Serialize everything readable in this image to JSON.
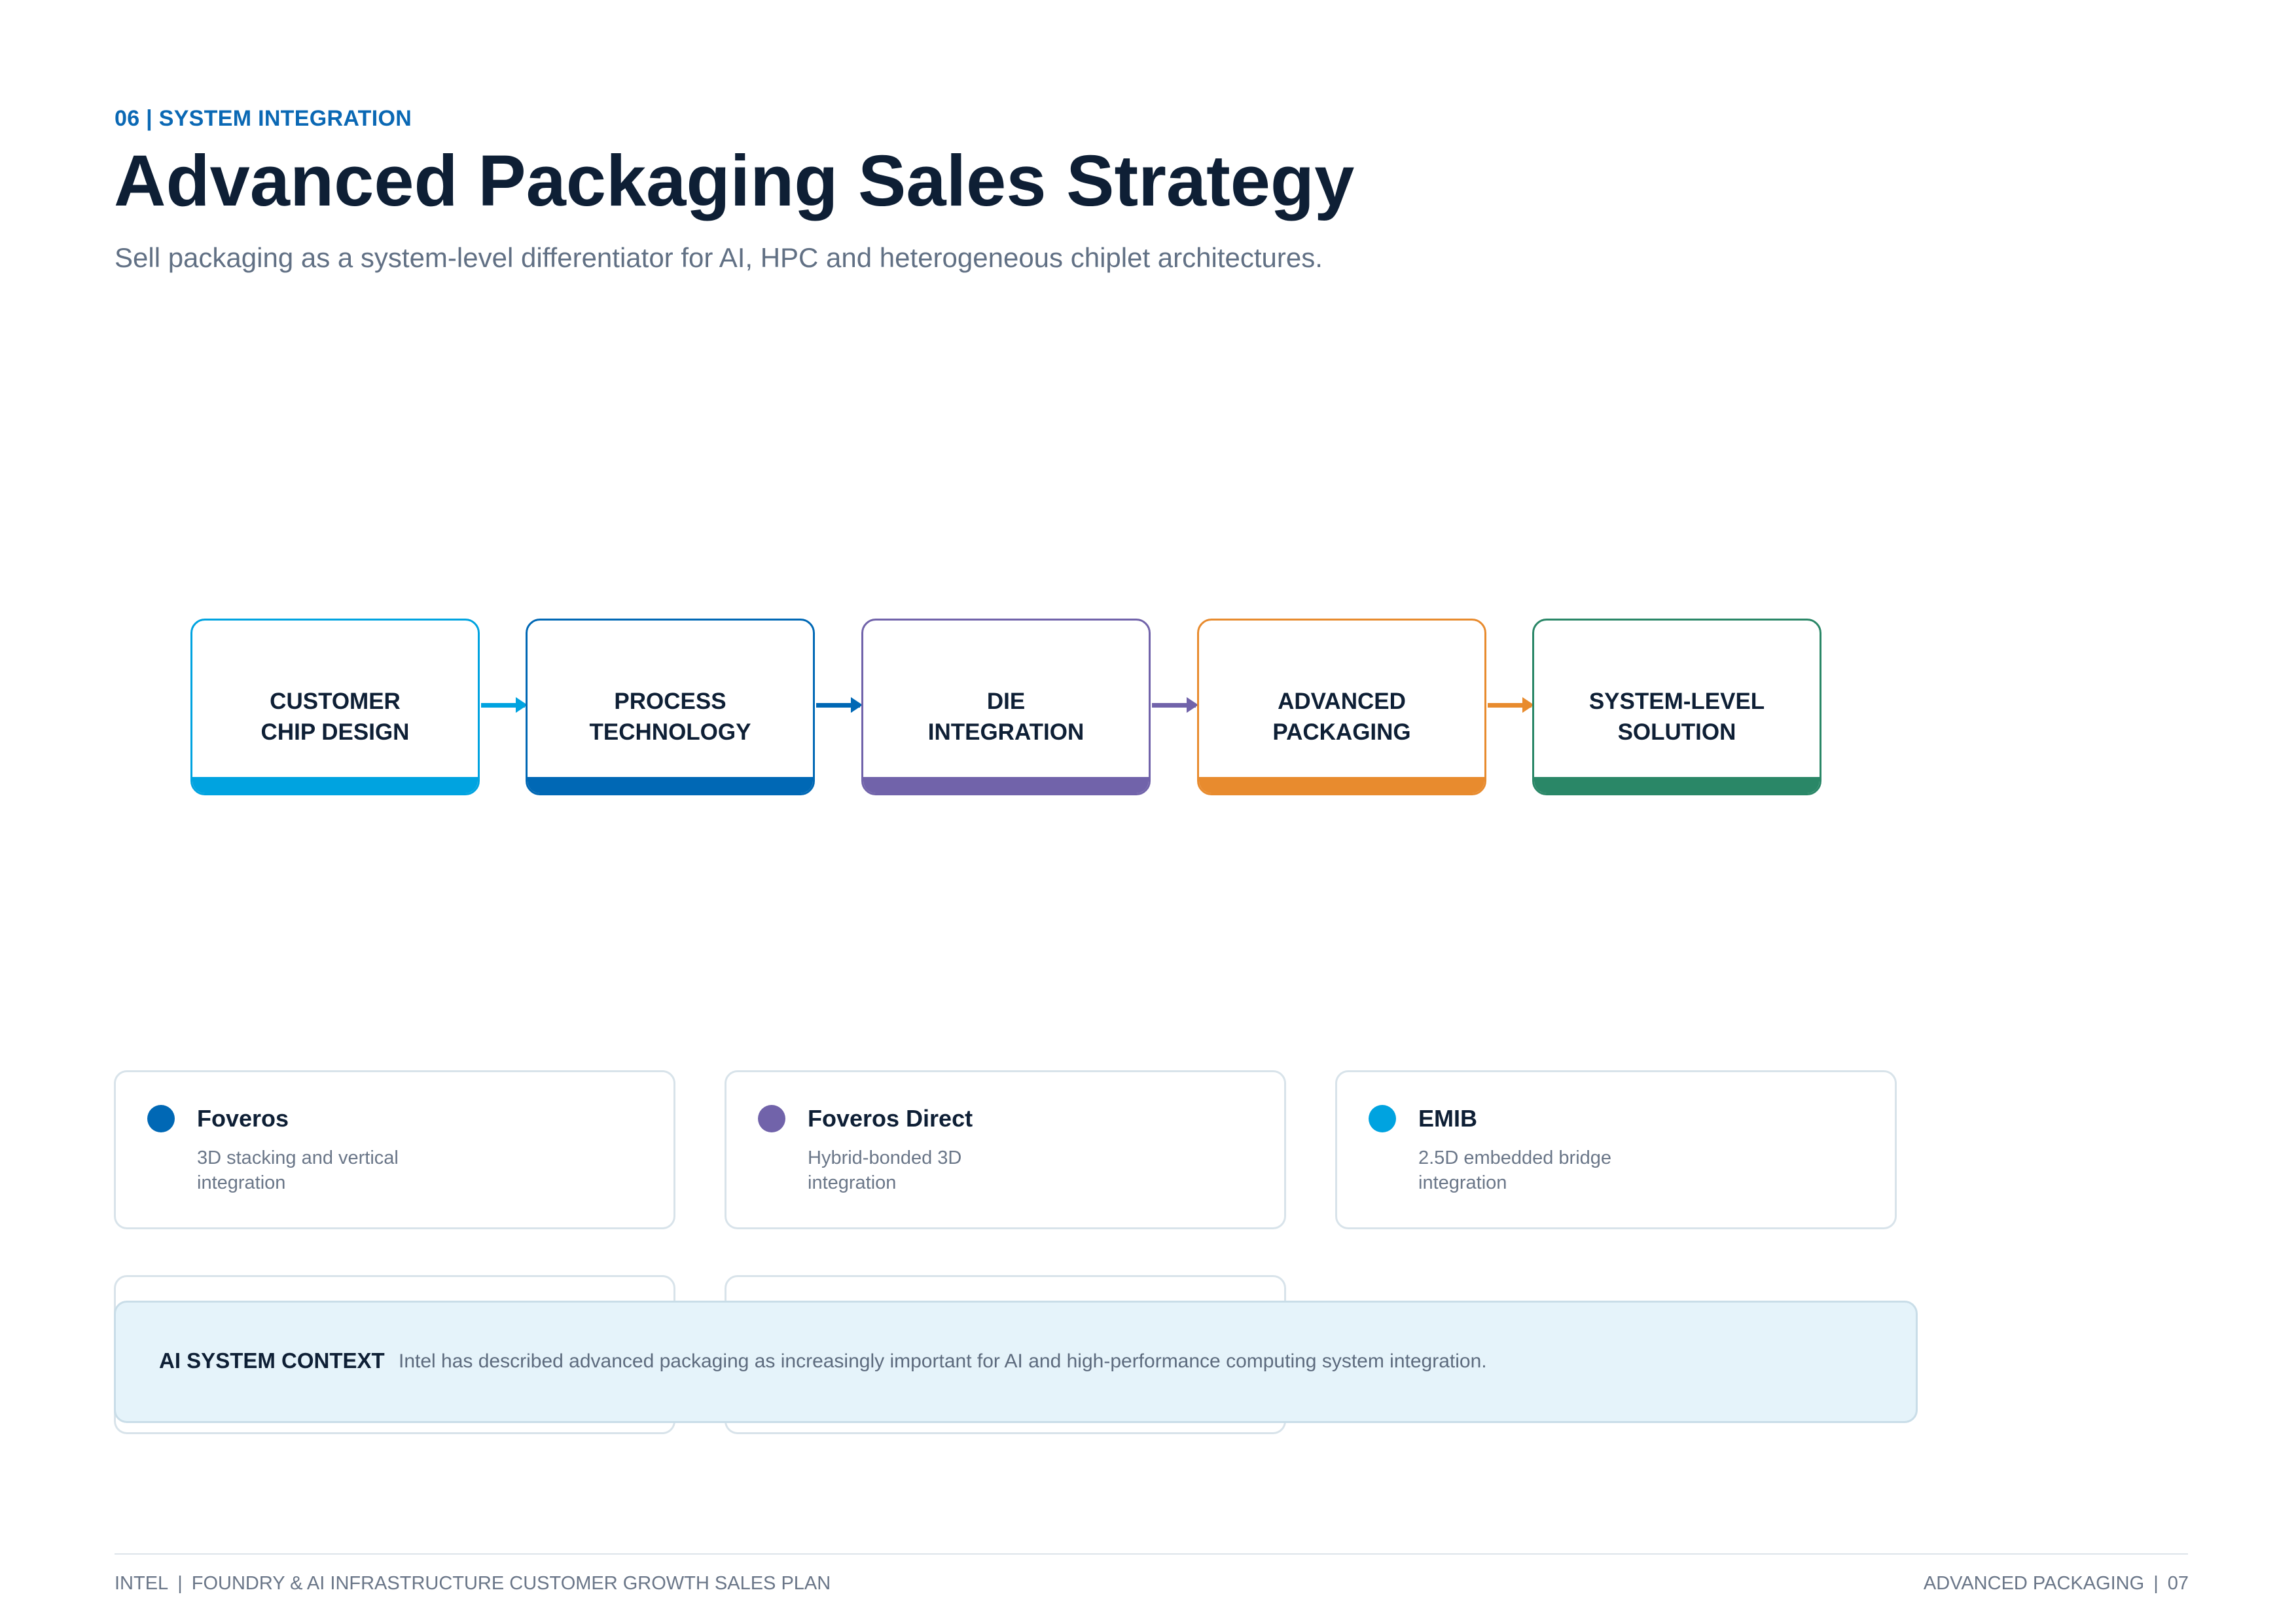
{
  "header": {
    "section_label": "06 | SYSTEM INTEGRATION",
    "title": "Advanced Packaging Sales Strategy",
    "subtitle": "Sell packaging as a system-level differentiator for AI, HPC and heterogeneous chiplet architectures."
  },
  "flow": {
    "steps": [
      {
        "line1": "CUSTOMER",
        "line2": "CHIP DESIGN",
        "color": "#00a3e0"
      },
      {
        "line1": "PROCESS",
        "line2": "TECHNOLOGY",
        "color": "#0068b5"
      },
      {
        "line1": "DIE",
        "line2": "INTEGRATION",
        "color": "#7163aa"
      },
      {
        "line1": "ADVANCED",
        "line2": "PACKAGING",
        "color": "#e88b2e"
      },
      {
        "line1": "SYSTEM-LEVEL",
        "line2": "SOLUTION",
        "color": "#2a8767"
      }
    ]
  },
  "technologies": [
    {
      "title": "Foveros",
      "description": "3D stacking and vertical integration",
      "color": "#0068b5"
    },
    {
      "title": "Foveros Direct",
      "description": "Hybrid-bonded 3D integration",
      "color": "#7163aa"
    },
    {
      "title": "EMIB",
      "description": "2.5D embedded bridge integration",
      "color": "#00a3e0"
    }
  ],
  "context": {
    "label": "AI SYSTEM CONTEXT",
    "text": "Intel has described advanced packaging as increasingly important for AI and high-performance computing system integration."
  },
  "footer": {
    "company": "INTEL",
    "plan": "FOUNDRY & AI INFRASTRUCTURE CUSTOMER GROWTH SALES PLAN",
    "section": "ADVANCED PACKAGING",
    "page": "07",
    "separator": "|"
  }
}
